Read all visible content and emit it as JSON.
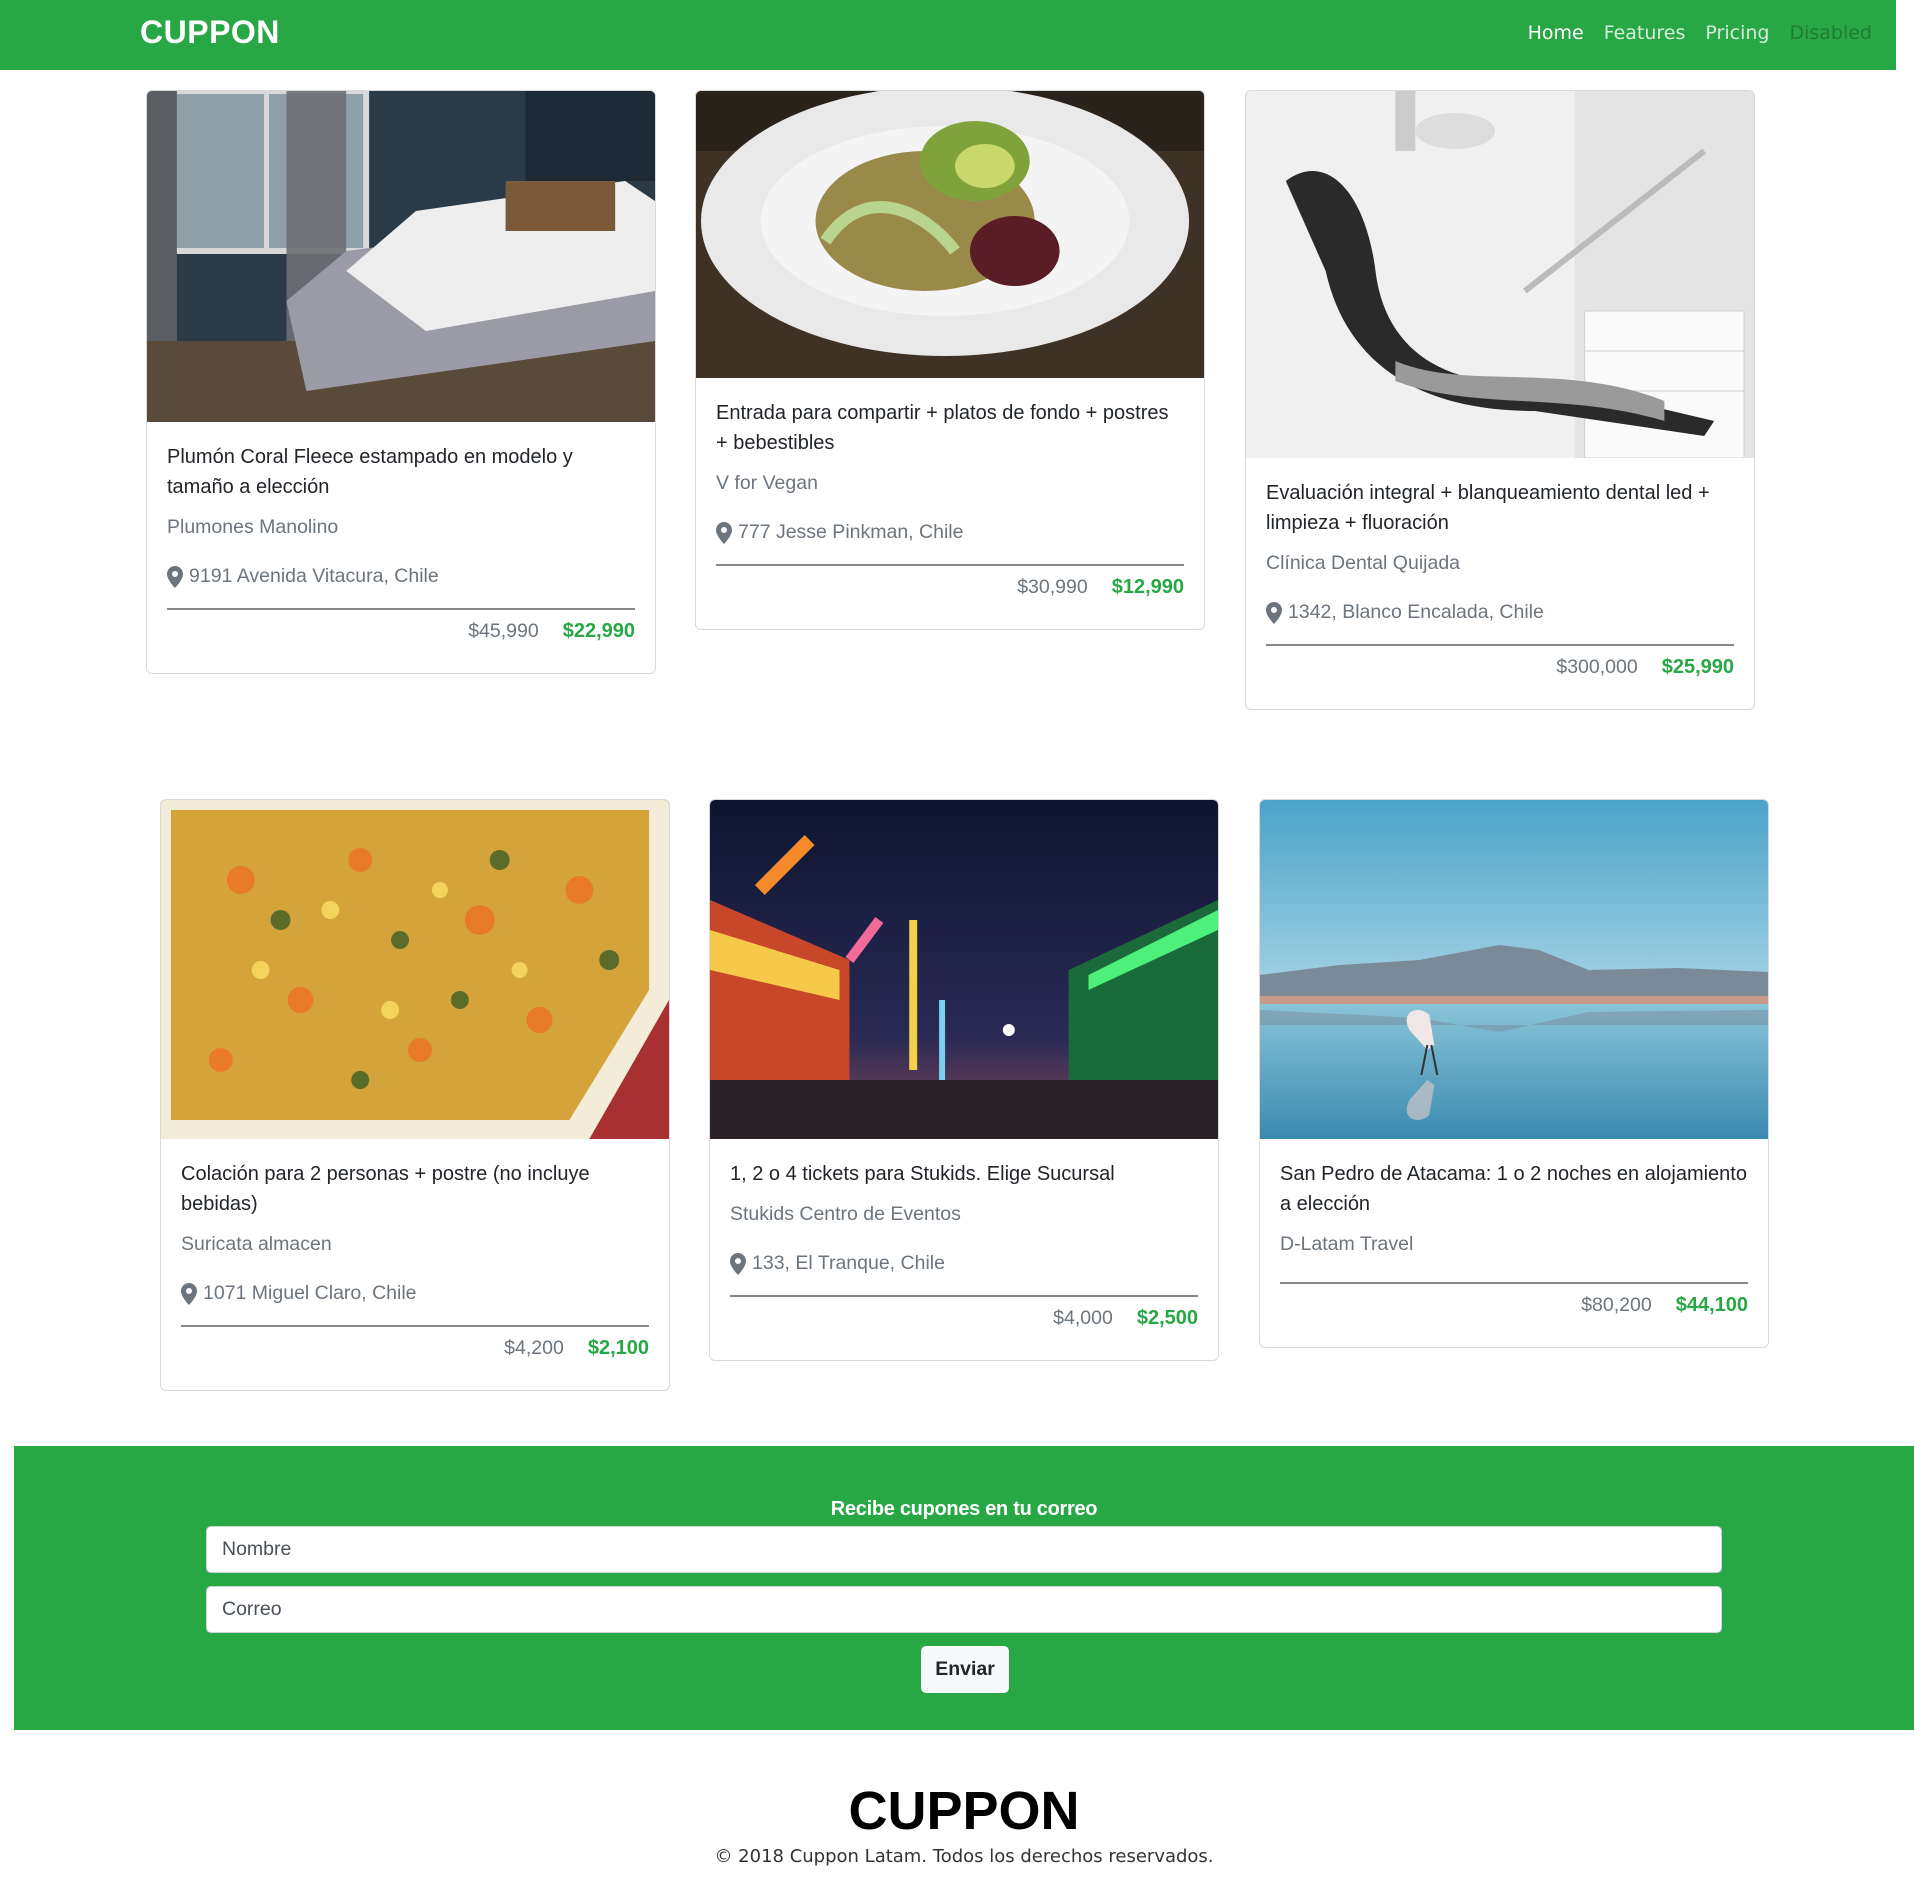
{
  "navbar": {
    "brand": "CUPPON",
    "links": [
      {
        "label": "Home"
      },
      {
        "label": "Features"
      },
      {
        "label": "Pricing"
      },
      {
        "label": "Disabled"
      }
    ]
  },
  "deals": [
    {
      "title": "Plumón Coral Fleece estampado en modelo y tamaño a elección",
      "merchant": "Plumones Manolino",
      "location": "9191 Avenida Vitacura, Chile",
      "old_price": "$45,990",
      "new_price": "$22,990",
      "image": "bedroom-photo"
    },
    {
      "title": "Entrada para compartir + platos de fondo + postres + bebestibles",
      "merchant": "V for Vegan",
      "location": "777 Jesse Pinkman, Chile",
      "old_price": "$30,990",
      "new_price": "$12,990",
      "image": "salad-plate-photo"
    },
    {
      "title": "Evaluación integral + blanqueamiento dental led + limpieza + fluoración",
      "merchant": "Clínica Dental Quijada",
      "location": "1342, Blanco Encalada, Chile",
      "old_price": "$300,000",
      "new_price": "$25,990",
      "image": "dental-chair-photo"
    },
    {
      "title": "Colación para 2 personas + postre (no incluye bebidas)",
      "merchant": "Suricata almacen",
      "location": "1071 Miguel Claro, Chile",
      "old_price": "$4,200",
      "new_price": "$2,100",
      "image": "vegetable-dish-photo"
    },
    {
      "title": "1, 2 o 4 tickets para Stukids. Elige Sucursal",
      "merchant": "Stukids Centro de Eventos",
      "location": "133, El Tranque, Chile",
      "old_price": "$4,000",
      "new_price": "$2,500",
      "image": "carnival-night-photo"
    },
    {
      "title": "San Pedro de Atacama: 1 o 2 noches en alojamiento a elección",
      "merchant": "D-Latam Travel",
      "location": "",
      "old_price": "$80,200",
      "new_price": "$44,100",
      "image": "flamingo-lake-photo"
    }
  ],
  "newsletter": {
    "title": "Recibe cupones en tu correo",
    "name_placeholder": "Nombre",
    "email_placeholder": "Correo",
    "submit_label": "Enviar"
  },
  "footer": {
    "brand": "CUPPON",
    "copyright": "© 2018 Cuppon Latam. Todos los derechos reservados."
  },
  "colors": {
    "brand_green": "#28a745",
    "muted_text": "#6c757d"
  }
}
